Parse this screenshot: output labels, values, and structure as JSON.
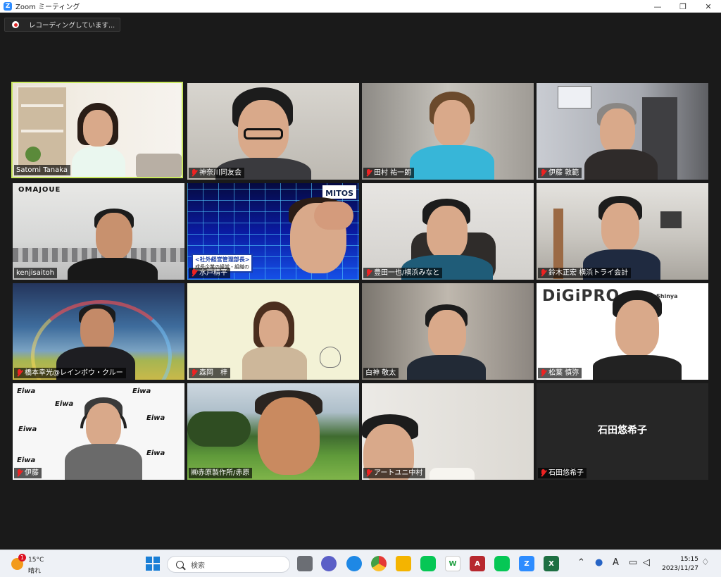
{
  "window": {
    "title": "Zoom ミーティング",
    "app_icon": "Z",
    "minimize": "—",
    "maximize": "❐",
    "close": "✕"
  },
  "recording": {
    "label": "レコーディングしています..."
  },
  "participants": [
    {
      "name": "Satomi Tanaka",
      "muted": false,
      "active": true
    },
    {
      "name": "神奈川同友会",
      "muted": true
    },
    {
      "name": "田村 祐一朗",
      "muted": true
    },
    {
      "name": "伊藤 敦範",
      "muted": true
    },
    {
      "name": "kenjisaitoh",
      "muted": false
    },
    {
      "name": "水戸精平",
      "muted": true
    },
    {
      "name": "豊田一也/横浜みなと",
      "muted": true
    },
    {
      "name": "鈴木正宏 横浜トライ会計",
      "muted": true
    },
    {
      "name": "橋本幸光@レインボウ・クルー",
      "muted": true
    },
    {
      "name": "森岡　梓",
      "muted": true
    },
    {
      "name": "白神 敬太",
      "muted": false
    },
    {
      "name": "松葉 慎弥",
      "muted": true
    },
    {
      "name": "伊藤",
      "muted": true
    },
    {
      "name": "㈱赤原製作所/赤原",
      "muted": false
    },
    {
      "name": "アートユニ中村",
      "muted": true
    },
    {
      "name": "石田悠希子",
      "muted": true,
      "no_video": true,
      "center_label": "石田悠希子"
    }
  ],
  "backgrounds": {
    "omajoue": "OMAJOUE",
    "mitos": "MITOS",
    "mitos_caption": "<社外経営管理部長>",
    "mitos_sub": "成長企業の経営・組織の",
    "digipro": "DiGiPRO",
    "digipro_sub": "Shinya",
    "eiwa": "Eiwa"
  },
  "taskbar": {
    "weather_temp": "15°C",
    "weather_cond": "晴れ",
    "weather_badge": "1",
    "search_placeholder": "検索",
    "time": "15:15",
    "date": "2023/11/27",
    "ime": "A"
  }
}
